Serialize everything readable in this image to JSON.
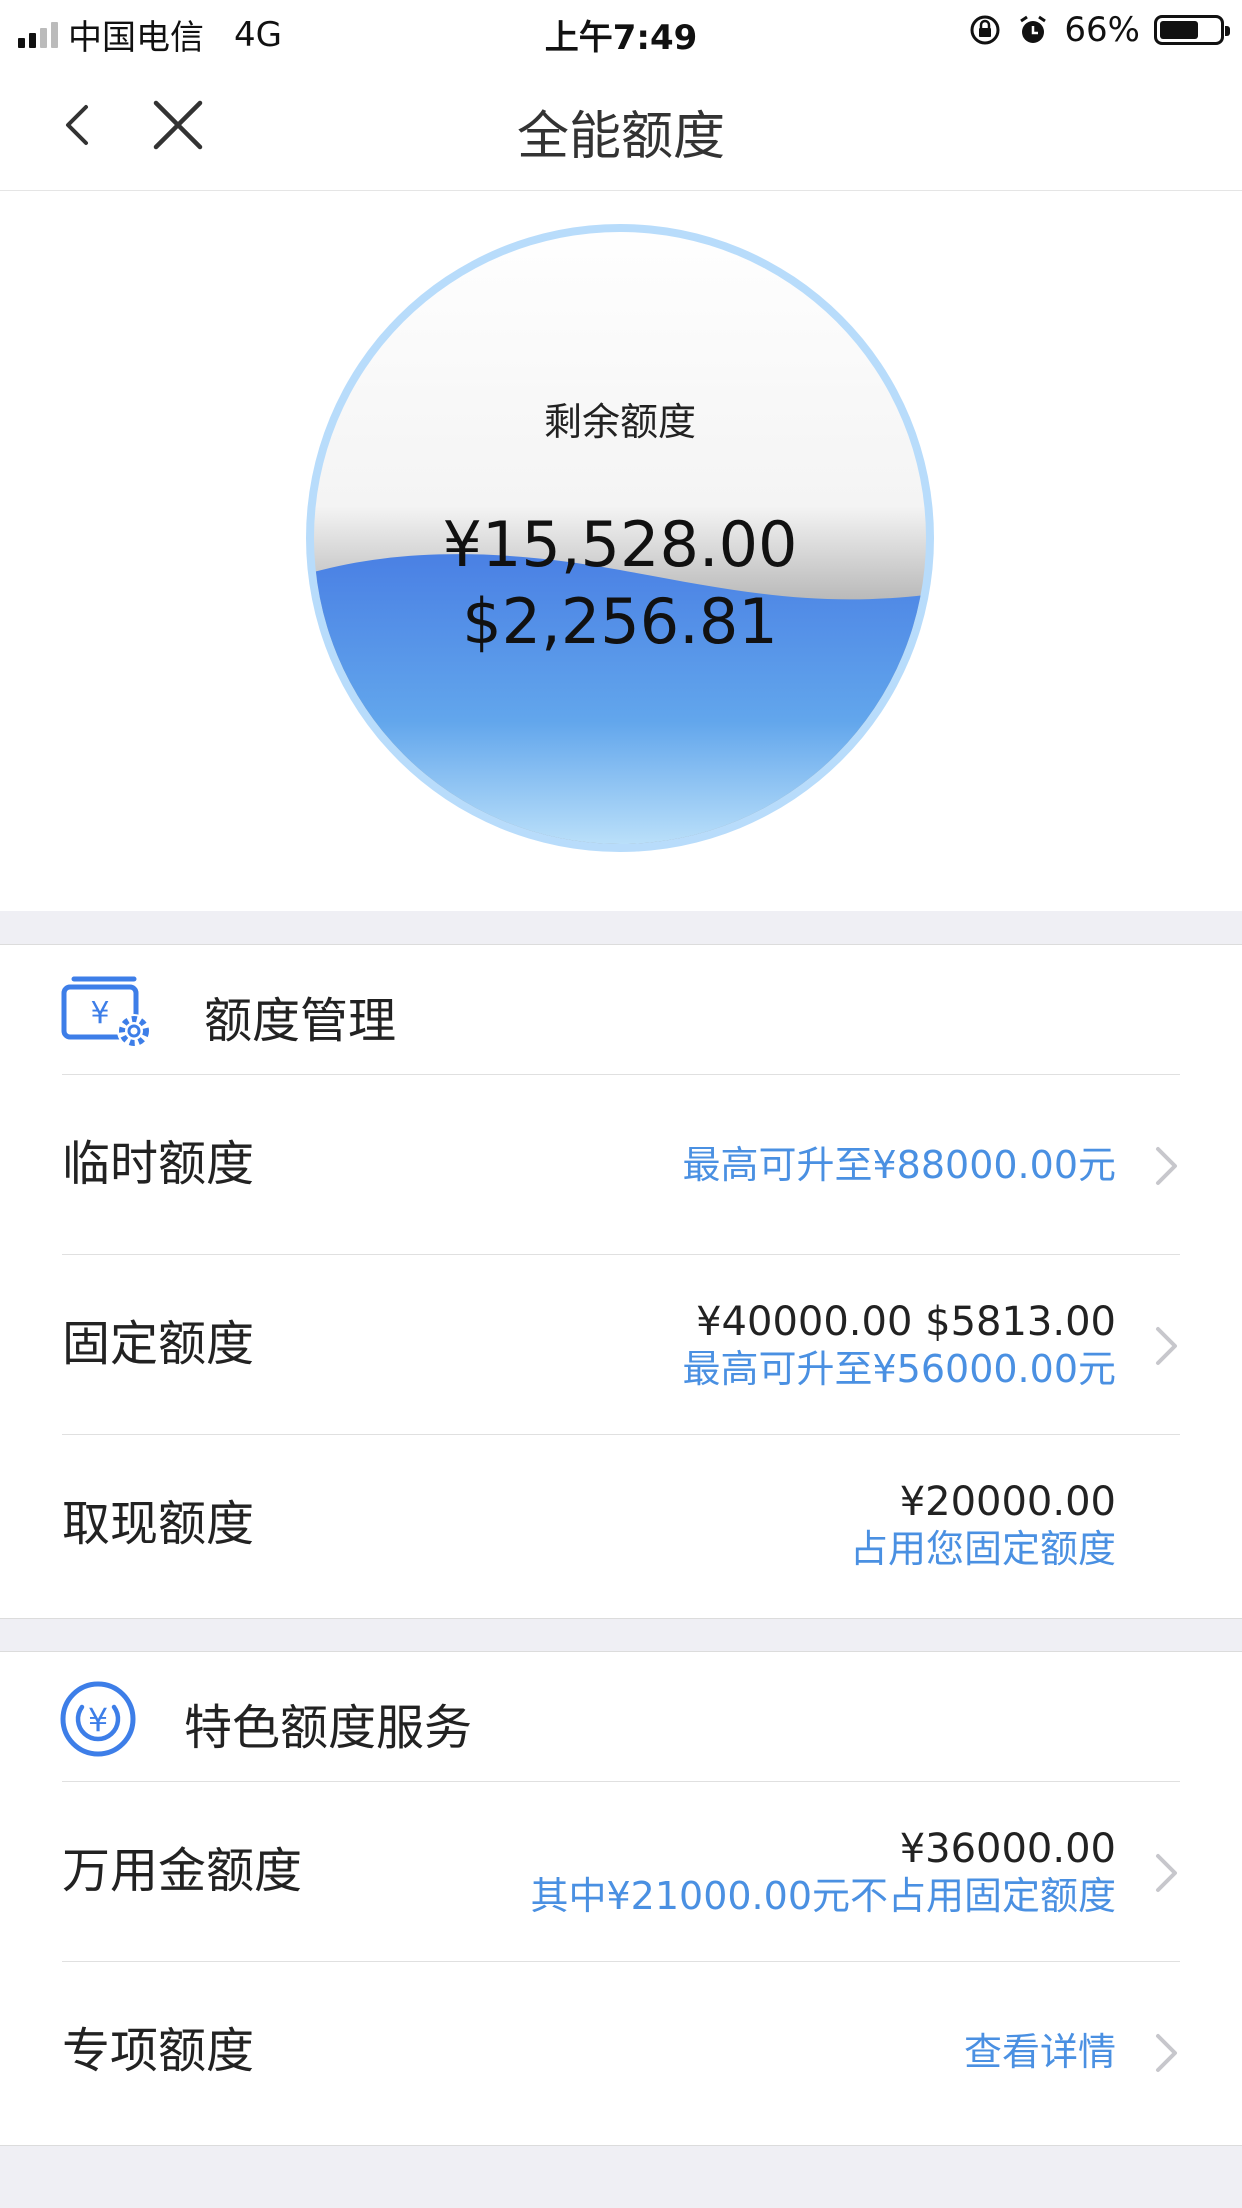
{
  "status_bar": {
    "carrier": "中国电信",
    "network": "4G",
    "time": "上午7:49",
    "battery_percent": "66%",
    "battery_level": 0.66
  },
  "nav": {
    "title": "全能额度",
    "back_icon": "chevron-left-icon",
    "close_icon": "close-icon"
  },
  "gauge": {
    "label": "剩余额度",
    "amount_cny": "¥15,528.00",
    "amount_usd": "$2,256.81",
    "water_color": "#4a86e8",
    "ring_color": "#b8dcfb"
  },
  "quota_management": {
    "title": "额度管理",
    "icon": "wallet-settings-icon",
    "items": [
      {
        "label": "临时额度",
        "main": "",
        "sub": "最高可升至¥88000.00元",
        "has_arrow": true
      },
      {
        "label": "固定额度",
        "main": "¥40000.00 $5813.00",
        "sub": "最高可升至¥56000.00元",
        "has_arrow": true
      },
      {
        "label": "取现额度",
        "main": "¥20000.00",
        "sub": "占用您固定额度",
        "has_arrow": false
      }
    ]
  },
  "special_services": {
    "title": "特色额度服务",
    "icon": "yuan-coin-icon",
    "items": [
      {
        "label": "万用金额度",
        "main": "¥36000.00",
        "sub": "其中¥21000.00元不占用固定额度",
        "has_arrow": true
      },
      {
        "label": "专项额度",
        "main": "",
        "sub": "查看详情",
        "has_arrow": true
      }
    ]
  },
  "colors": {
    "accent_blue": "#4a90e2",
    "icon_blue": "#3d7ee8"
  }
}
